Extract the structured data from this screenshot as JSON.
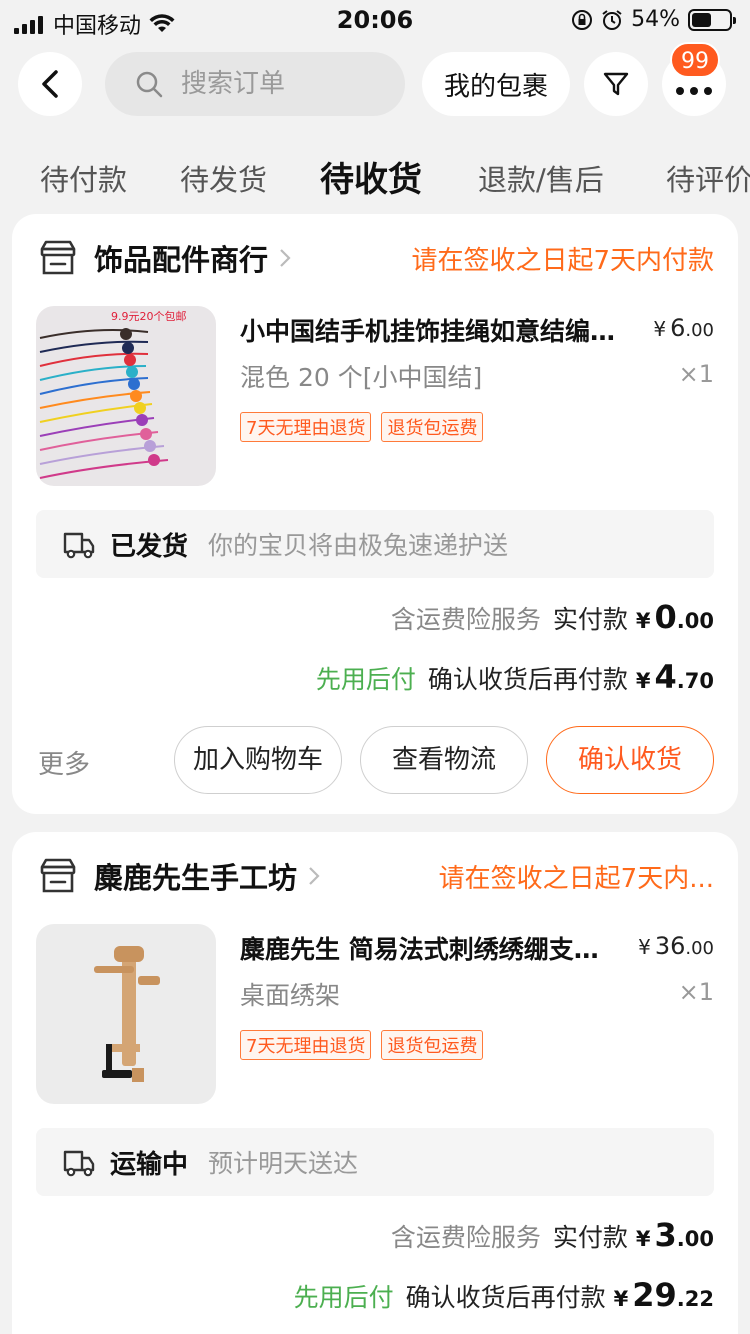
{
  "status_bar": {
    "carrier": "中国移动",
    "time": "20:06",
    "battery_pct": "54%",
    "battery_level": 0.54
  },
  "topbar": {
    "search_placeholder": "搜索订单",
    "packages_label": "我的包裹",
    "badge_count": "99"
  },
  "tabs": [
    {
      "label": "待付款",
      "active": false
    },
    {
      "label": "待发货",
      "active": false
    },
    {
      "label": "待收货",
      "active": true
    },
    {
      "label": "退款/售后",
      "active": false
    },
    {
      "label": "待评价",
      "active": false
    }
  ],
  "orders": [
    {
      "shop_name": "饰品配件商行",
      "notice": "请在签收之日起7天内付款",
      "item": {
        "title": "小中国结手机挂饰挂绳如意结编织绳",
        "price_int": "6",
        "price_dec": ".00",
        "spec": "混色 20 个[小中国结]",
        "qty": "×1",
        "tags": [
          "7天无理由退货",
          "退货包运费"
        ],
        "thumb_text": "9.9元20个包邮"
      },
      "shipping": {
        "status": "已发货",
        "desc": "你的宝贝将由极兔速递护送"
      },
      "insurance": "含运费险服务",
      "paid_label": "实付款",
      "paid_int": "0",
      "paid_dec": ".00",
      "later_label": "先用后付",
      "later_desc": "确认收货后再付款",
      "later_int": "4",
      "later_dec": ".70",
      "more": "更多",
      "buttons": [
        "加入购物车",
        "查看物流",
        "确认收货"
      ]
    },
    {
      "shop_name": "麋鹿先生手工坊",
      "notice": "请在签收之日起7天内...",
      "item": {
        "title": "麋鹿先生 简易法式刺绣绣绷支架桌面款",
        "price_int": "36",
        "price_dec": ".00",
        "spec": "桌面绣架",
        "qty": "×1",
        "tags": [
          "7天无理由退货",
          "退货包运费"
        ]
      },
      "shipping": {
        "status": "运输中",
        "desc": "预计明天送达"
      },
      "insurance": "含运费险服务",
      "paid_label": "实付款",
      "paid_int": "3",
      "paid_dec": ".00",
      "later_label": "先用后付",
      "later_desc": "确认收货后再付款",
      "later_int": "29",
      "later_dec": ".22"
    }
  ],
  "colors": {
    "accent": "#ff6a1a",
    "green": "#4caf50",
    "badge": "#ff5a1f"
  },
  "yen": "¥"
}
